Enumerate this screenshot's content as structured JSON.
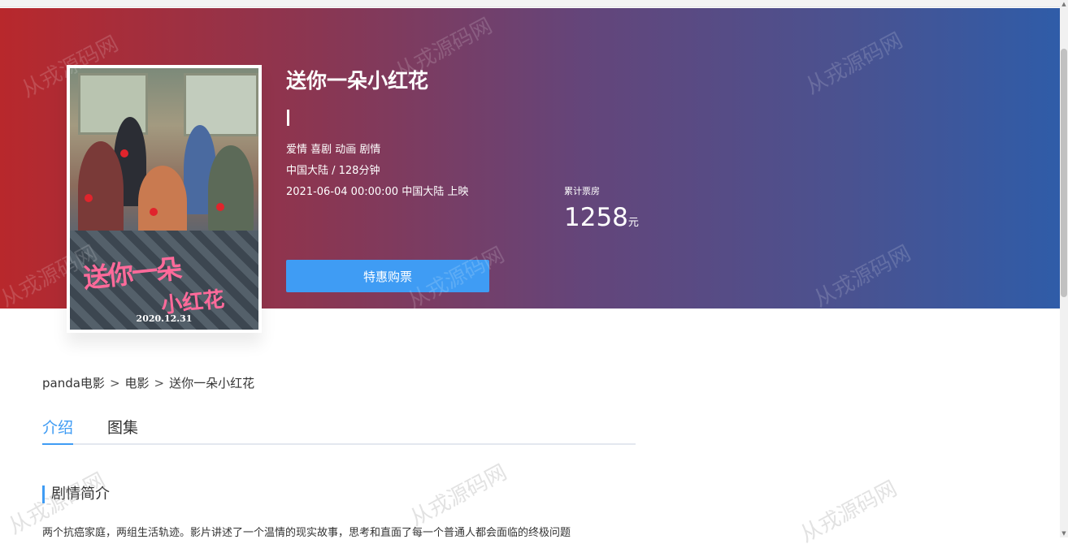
{
  "movie": {
    "title": "送你一朵小红花",
    "subtitle_mark": "|",
    "genres": "爱情 喜剧 动画 剧情",
    "region_duration": "中国大陆 / 128分钟",
    "release": "2021-06-04 00:00:00 中国大陆 上映",
    "poster": {
      "title_line1": "送你一朵",
      "title_line2": "小红花",
      "date": "2020.12.31"
    }
  },
  "box_office": {
    "label": "累计票房",
    "value": "1258",
    "unit": "元"
  },
  "buy_button": {
    "label": "特惠购票"
  },
  "breadcrumb": {
    "items": [
      "panda电影",
      "电影",
      "送你一朵小红花"
    ],
    "separator": ">"
  },
  "tabs": [
    {
      "label": "介绍",
      "active": true
    },
    {
      "label": "图集",
      "active": false
    }
  ],
  "section": {
    "title": "剧情简介",
    "synopsis": "两个抗癌家庭，两组生活轨迹。影片讲述了一个温情的现实故事，思考和直面了每一个普通人都会面临的终极问题"
  },
  "watermark": "从戎源码网",
  "colors": {
    "accent": "#3f9cf4",
    "banner_left": "#b8282c",
    "banner_right": "#2f5ca8"
  }
}
